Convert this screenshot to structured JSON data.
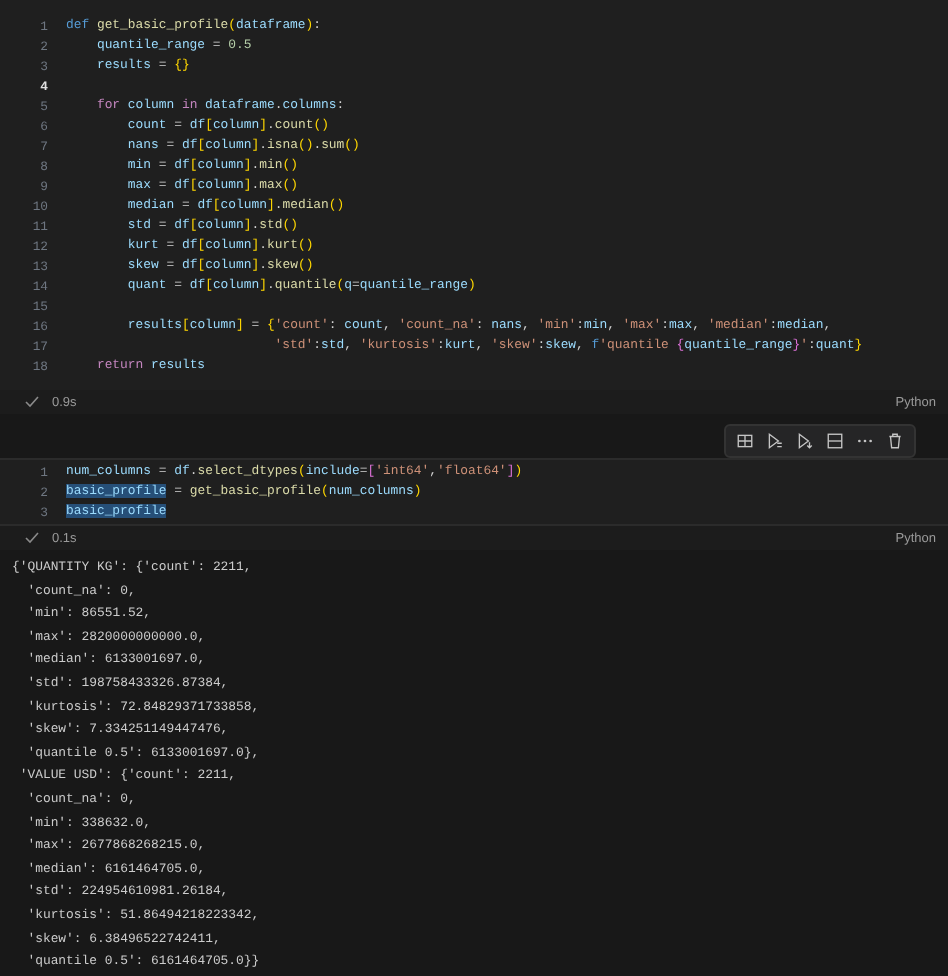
{
  "cells": [
    {
      "lines": [
        {
          "number": "1",
          "active": false,
          "tokens": [
            {
              "kind": "kw",
              "text": "def "
            },
            {
              "kind": "fn",
              "text": "get_basic_profile"
            },
            {
              "kind": "br1",
              "text": "("
            },
            {
              "kind": "var",
              "text": "dataframe"
            },
            {
              "kind": "br1",
              "text": ")"
            },
            {
              "kind": "op",
              "text": ":"
            }
          ]
        },
        {
          "number": "2",
          "active": false,
          "tokens": [
            {
              "kind": "var",
              "text": "    quantile_range"
            },
            {
              "kind": "op",
              "text": " = "
            },
            {
              "kind": "num",
              "text": "0.5"
            }
          ]
        },
        {
          "number": "3",
          "active": false,
          "tokens": [
            {
              "kind": "var",
              "text": "    results"
            },
            {
              "kind": "op",
              "text": " = "
            },
            {
              "kind": "br1",
              "text": "{}"
            }
          ]
        },
        {
          "number": "4",
          "active": true
        },
        {
          "number": "5",
          "active": false,
          "tokens": [
            {
              "kind": "ctl",
              "text": "    for "
            },
            {
              "kind": "var",
              "text": "column"
            },
            {
              "kind": "ctl",
              "text": " in "
            },
            {
              "kind": "var",
              "text": "dataframe"
            },
            {
              "kind": "op",
              "text": "."
            },
            {
              "kind": "var",
              "text": "columns"
            },
            {
              "kind": "op",
              "text": ":"
            }
          ]
        },
        {
          "number": "6",
          "active": false,
          "tokens": [
            {
              "kind": "var",
              "text": "        count"
            },
            {
              "kind": "op",
              "text": " = "
            },
            {
              "kind": "var",
              "text": "df"
            },
            {
              "kind": "br1",
              "text": "["
            },
            {
              "kind": "var",
              "text": "column"
            },
            {
              "kind": "br1",
              "text": "]"
            },
            {
              "kind": "op",
              "text": "."
            },
            {
              "kind": "fn",
              "text": "count"
            },
            {
              "kind": "br1",
              "text": "()"
            }
          ]
        },
        {
          "number": "7",
          "active": false,
          "tokens": [
            {
              "kind": "var",
              "text": "        nans"
            },
            {
              "kind": "op",
              "text": " = "
            },
            {
              "kind": "var",
              "text": "df"
            },
            {
              "kind": "br1",
              "text": "["
            },
            {
              "kind": "var",
              "text": "column"
            },
            {
              "kind": "br1",
              "text": "]"
            },
            {
              "kind": "op",
              "text": "."
            },
            {
              "kind": "fn",
              "text": "isna"
            },
            {
              "kind": "br1",
              "text": "()"
            },
            {
              "kind": "op",
              "text": "."
            },
            {
              "kind": "fn",
              "text": "sum"
            },
            {
              "kind": "br1",
              "text": "()"
            }
          ]
        },
        {
          "number": "8",
          "active": false,
          "tokens": [
            {
              "kind": "var",
              "text": "        min"
            },
            {
              "kind": "op",
              "text": " = "
            },
            {
              "kind": "var",
              "text": "df"
            },
            {
              "kind": "br1",
              "text": "["
            },
            {
              "kind": "var",
              "text": "column"
            },
            {
              "kind": "br1",
              "text": "]"
            },
            {
              "kind": "op",
              "text": "."
            },
            {
              "kind": "fn",
              "text": "min"
            },
            {
              "kind": "br1",
              "text": "()"
            }
          ]
        },
        {
          "number": "9",
          "active": false,
          "tokens": [
            {
              "kind": "var",
              "text": "        max"
            },
            {
              "kind": "op",
              "text": " = "
            },
            {
              "kind": "var",
              "text": "df"
            },
            {
              "kind": "br1",
              "text": "["
            },
            {
              "kind": "var",
              "text": "column"
            },
            {
              "kind": "br1",
              "text": "]"
            },
            {
              "kind": "op",
              "text": "."
            },
            {
              "kind": "fn",
              "text": "max"
            },
            {
              "kind": "br1",
              "text": "()"
            }
          ]
        },
        {
          "number": "10",
          "active": false,
          "tokens": [
            {
              "kind": "var",
              "text": "        median"
            },
            {
              "kind": "op",
              "text": " = "
            },
            {
              "kind": "var",
              "text": "df"
            },
            {
              "kind": "br1",
              "text": "["
            },
            {
              "kind": "var",
              "text": "column"
            },
            {
              "kind": "br1",
              "text": "]"
            },
            {
              "kind": "op",
              "text": "."
            },
            {
              "kind": "fn",
              "text": "median"
            },
            {
              "kind": "br1",
              "text": "()"
            }
          ]
        },
        {
          "number": "11",
          "active": false,
          "tokens": [
            {
              "kind": "var",
              "text": "        std"
            },
            {
              "kind": "op",
              "text": " = "
            },
            {
              "kind": "var",
              "text": "df"
            },
            {
              "kind": "br1",
              "text": "["
            },
            {
              "kind": "var",
              "text": "column"
            },
            {
              "kind": "br1",
              "text": "]"
            },
            {
              "kind": "op",
              "text": "."
            },
            {
              "kind": "fn",
              "text": "std"
            },
            {
              "kind": "br1",
              "text": "()"
            }
          ]
        },
        {
          "number": "12",
          "active": false,
          "tokens": [
            {
              "kind": "var",
              "text": "        kurt"
            },
            {
              "kind": "op",
              "text": " = "
            },
            {
              "kind": "var",
              "text": "df"
            },
            {
              "kind": "br1",
              "text": "["
            },
            {
              "kind": "var",
              "text": "column"
            },
            {
              "kind": "br1",
              "text": "]"
            },
            {
              "kind": "op",
              "text": "."
            },
            {
              "kind": "fn",
              "text": "kurt"
            },
            {
              "kind": "br1",
              "text": "()"
            }
          ]
        },
        {
          "number": "13",
          "active": false,
          "tokens": [
            {
              "kind": "var",
              "text": "        skew"
            },
            {
              "kind": "op",
              "text": " = "
            },
            {
              "kind": "var",
              "text": "df"
            },
            {
              "kind": "br1",
              "text": "["
            },
            {
              "kind": "var",
              "text": "column"
            },
            {
              "kind": "br1",
              "text": "]"
            },
            {
              "kind": "op",
              "text": "."
            },
            {
              "kind": "fn",
              "text": "skew"
            },
            {
              "kind": "br1",
              "text": "()"
            }
          ]
        },
        {
          "number": "14",
          "active": false,
          "tokens": [
            {
              "kind": "var",
              "text": "        quant"
            },
            {
              "kind": "op",
              "text": " = "
            },
            {
              "kind": "var",
              "text": "df"
            },
            {
              "kind": "br1",
              "text": "["
            },
            {
              "kind": "var",
              "text": "column"
            },
            {
              "kind": "br1",
              "text": "]"
            },
            {
              "kind": "op",
              "text": "."
            },
            {
              "kind": "fn",
              "text": "quantile"
            },
            {
              "kind": "br1",
              "text": "("
            },
            {
              "kind": "var",
              "text": "q"
            },
            {
              "kind": "op",
              "text": "="
            },
            {
              "kind": "var",
              "text": "quantile_range"
            },
            {
              "kind": "br1",
              "text": ")"
            }
          ]
        },
        {
          "number": "15",
          "active": false
        },
        {
          "number": "16",
          "active": false,
          "tokens": [
            {
              "kind": "var",
              "text": "        results"
            },
            {
              "kind": "br1",
              "text": "["
            },
            {
              "kind": "var",
              "text": "column"
            },
            {
              "kind": "br1",
              "text": "]"
            },
            {
              "kind": "op",
              "text": " = "
            },
            {
              "kind": "br1",
              "text": "{"
            },
            {
              "kind": "str",
              "text": "'count'"
            },
            {
              "kind": "op",
              "text": ": "
            },
            {
              "kind": "var",
              "text": "count"
            },
            {
              "kind": "op",
              "text": ", "
            },
            {
              "kind": "str",
              "text": "'count_na'"
            },
            {
              "kind": "op",
              "text": ": "
            },
            {
              "kind": "var",
              "text": "nans"
            },
            {
              "kind": "op",
              "text": ", "
            },
            {
              "kind": "str",
              "text": "'min'"
            },
            {
              "kind": "op",
              "text": ":"
            },
            {
              "kind": "var",
              "text": "min"
            },
            {
              "kind": "op",
              "text": ", "
            },
            {
              "kind": "str",
              "text": "'max'"
            },
            {
              "kind": "op",
              "text": ":"
            },
            {
              "kind": "var",
              "text": "max"
            },
            {
              "kind": "op",
              "text": ", "
            },
            {
              "kind": "str",
              "text": "'median'"
            },
            {
              "kind": "op",
              "text": ":"
            },
            {
              "kind": "var",
              "text": "median"
            },
            {
              "kind": "op",
              "text": ","
            }
          ]
        },
        {
          "number": "17",
          "active": false,
          "tokens": [
            {
              "kind": "str",
              "text": "                           'std'"
            },
            {
              "kind": "op",
              "text": ":"
            },
            {
              "kind": "var",
              "text": "std"
            },
            {
              "kind": "op",
              "text": ", "
            },
            {
              "kind": "str",
              "text": "'kurtosis'"
            },
            {
              "kind": "op",
              "text": ":"
            },
            {
              "kind": "var",
              "text": "kurt"
            },
            {
              "kind": "op",
              "text": ", "
            },
            {
              "kind": "str",
              "text": "'skew'"
            },
            {
              "kind": "op",
              "text": ":"
            },
            {
              "kind": "var",
              "text": "skew"
            },
            {
              "kind": "op",
              "text": ", "
            },
            {
              "kind": "kw",
              "text": "f"
            },
            {
              "kind": "str",
              "text": "'quantile "
            },
            {
              "kind": "br2",
              "text": "{"
            },
            {
              "kind": "var",
              "text": "quantile_range"
            },
            {
              "kind": "br2",
              "text": "}"
            },
            {
              "kind": "str",
              "text": "'"
            },
            {
              "kind": "op",
              "text": ":"
            },
            {
              "kind": "var",
              "text": "quant"
            },
            {
              "kind": "br1",
              "text": "}"
            }
          ]
        },
        {
          "number": "18",
          "active": false,
          "tokens": [
            {
              "kind": "ctl",
              "text": "    return "
            },
            {
              "kind": "var",
              "text": "results"
            }
          ]
        }
      ],
      "status": {
        "succeeded": true,
        "time": "0.9s",
        "language": "Python"
      }
    },
    {
      "toolbar": true,
      "lines": [
        {
          "number": "1",
          "active": false,
          "tokens": [
            {
              "kind": "var",
              "text": "num_columns"
            },
            {
              "kind": "op",
              "text": " = "
            },
            {
              "kind": "var",
              "text": "df"
            },
            {
              "kind": "op",
              "text": "."
            },
            {
              "kind": "fn",
              "text": "select_dtypes"
            },
            {
              "kind": "br1",
              "text": "("
            },
            {
              "kind": "var",
              "text": "include"
            },
            {
              "kind": "op",
              "text": "="
            },
            {
              "kind": "br2",
              "text": "["
            },
            {
              "kind": "str",
              "text": "'int64'"
            },
            {
              "kind": "op",
              "text": ","
            },
            {
              "kind": "str",
              "text": "'float64'"
            },
            {
              "kind": "br2",
              "text": "]"
            },
            {
              "kind": "br1",
              "text": ")"
            }
          ]
        },
        {
          "number": "2",
          "active": false,
          "tokens": [
            {
              "kind": "sel",
              "text": "basic_profile"
            },
            {
              "kind": "op",
              "text": " = "
            },
            {
              "kind": "fn",
              "text": "get_basic_profile"
            },
            {
              "kind": "br1",
              "text": "("
            },
            {
              "kind": "var",
              "text": "num_columns"
            },
            {
              "kind": "br1",
              "text": ")"
            }
          ]
        },
        {
          "number": "3",
          "active": false,
          "tokens": [
            {
              "kind": "sel",
              "text": "basic_profile"
            }
          ]
        }
      ],
      "status": {
        "succeeded": true,
        "time": "0.1s",
        "language": "Python"
      },
      "output": [
        "{'QUANTITY KG': {'count': 2211,",
        "  'count_na': 0,",
        "  'min': 86551.52,",
        "  'max': 2820000000000.0,",
        "  'median': 6133001697.0,",
        "  'std': 198758433326.87384,",
        "  'kurtosis': 72.84829371733858,",
        "  'skew': 7.334251149447476,",
        "  'quantile 0.5': 6133001697.0},",
        " 'VALUE USD': {'count': 2211,",
        "  'count_na': 0,",
        "  'min': 338632.0,",
        "  'max': 2677868268215.0,",
        "  'median': 6161464705.0,",
        "  'std': 224954610981.26184,",
        "  'kurtosis': 51.86494218223342,",
        "  'skew': 6.38496522742411,",
        "  'quantile 0.5': 6161464705.0}}"
      ]
    }
  ]
}
